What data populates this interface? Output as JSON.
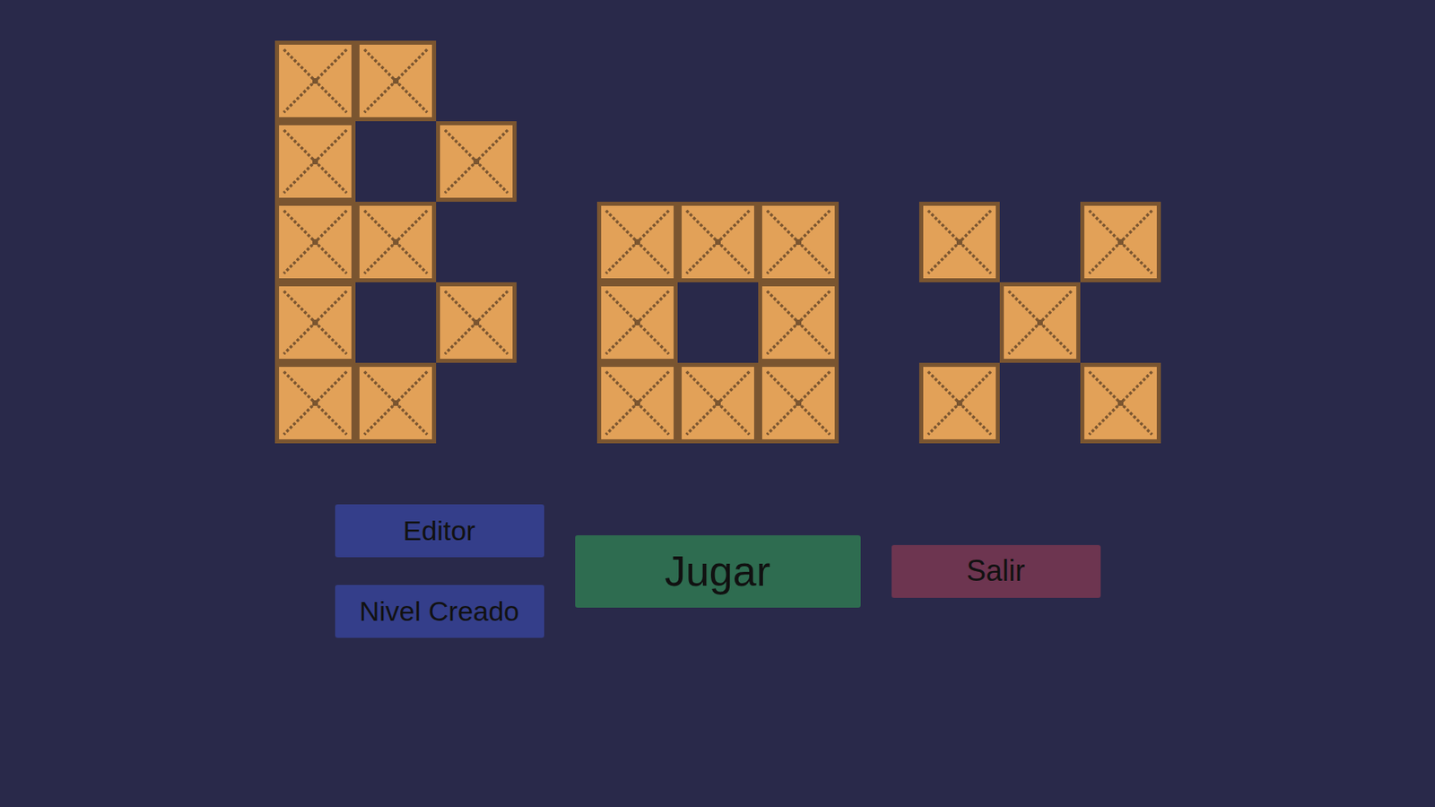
{
  "logo": {
    "letters": [
      {
        "rows": [
          [
            true,
            true,
            false
          ],
          [
            true,
            false,
            true
          ],
          [
            true,
            true,
            false
          ],
          [
            true,
            false,
            true
          ],
          [
            true,
            true,
            false
          ]
        ]
      },
      {
        "rows": [
          [
            false,
            false,
            false
          ],
          [
            false,
            false,
            false
          ],
          [
            true,
            true,
            true
          ],
          [
            true,
            false,
            true
          ],
          [
            true,
            true,
            true
          ]
        ]
      },
      {
        "rows": [
          [
            false,
            false,
            false
          ],
          [
            false,
            false,
            false
          ],
          [
            true,
            false,
            true
          ],
          [
            false,
            true,
            false
          ],
          [
            true,
            false,
            true
          ]
        ]
      }
    ]
  },
  "side_buttons": [
    {
      "label": "Editor"
    },
    {
      "label": "Nivel Creado"
    }
  ],
  "play_button": {
    "label": "Jugar"
  },
  "exit_button": {
    "label": "Salir"
  }
}
